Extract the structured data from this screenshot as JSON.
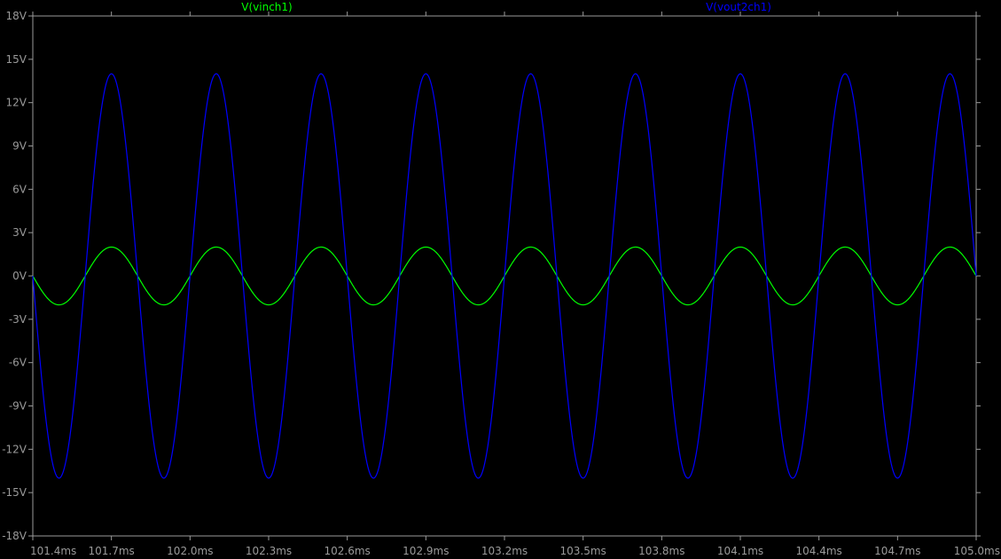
{
  "chart_data": {
    "type": "line",
    "xlabel": "",
    "ylabel": "",
    "xlim": [
      101.4,
      105.0
    ],
    "ylim": [
      -18,
      18
    ],
    "x_unit": "ms",
    "y_unit": "V",
    "x_ticks": [
      "101.4ms",
      "101.7ms",
      "102.0ms",
      "102.3ms",
      "102.6ms",
      "102.9ms",
      "103.2ms",
      "103.5ms",
      "103.8ms",
      "104.1ms",
      "104.4ms",
      "104.7ms",
      "105.0ms"
    ],
    "y_ticks": [
      "18V",
      "15V",
      "12V",
      "9V",
      "6V",
      "3V",
      "0V",
      "-3V",
      "-6V",
      "-9V",
      "-12V",
      "-15V",
      "-18V"
    ],
    "grid": false,
    "legend_position": "top",
    "series": [
      {
        "name": "V(vinch1)",
        "color": "#00ff00",
        "waveform": "sine",
        "amplitude": 2,
        "offset": 0,
        "period_ms": 0.4,
        "x": [
          101.4,
          101.5,
          101.6,
          101.7,
          101.8,
          101.9,
          102.0,
          102.1,
          102.2,
          102.3,
          102.4,
          102.5,
          102.6,
          102.7,
          102.8,
          102.9,
          103.0,
          103.1,
          103.2,
          103.3,
          103.4,
          103.5,
          103.6,
          103.7,
          103.8,
          103.9,
          104.0,
          104.1,
          104.2,
          104.3,
          104.4,
          104.5,
          104.6,
          104.7,
          104.8,
          104.9,
          105.0
        ],
        "values": [
          0,
          -2,
          0,
          2,
          0,
          -2,
          0,
          2,
          0,
          -2,
          0,
          2,
          0,
          -2,
          0,
          2,
          0,
          -2,
          0,
          2,
          0,
          -2,
          0,
          2,
          0,
          -2,
          0,
          2,
          0,
          -2,
          0,
          2,
          0,
          -2,
          0,
          2,
          0
        ]
      },
      {
        "name": "V(vout2ch1)",
        "color": "#0000ff",
        "waveform": "sine",
        "amplitude": 14,
        "offset": 0,
        "period_ms": 0.4,
        "x": [
          101.4,
          101.5,
          101.6,
          101.7,
          101.8,
          101.9,
          102.0,
          102.1,
          102.2,
          102.3,
          102.4,
          102.5,
          102.6,
          102.7,
          102.8,
          102.9,
          103.0,
          103.1,
          103.2,
          103.3,
          103.4,
          103.5,
          103.6,
          103.7,
          103.8,
          103.9,
          104.0,
          104.1,
          104.2,
          104.3,
          104.4,
          104.5,
          104.6,
          104.7,
          104.8,
          104.9,
          105.0
        ],
        "values": [
          0,
          -14,
          0,
          14,
          0,
          -14,
          0,
          14,
          0,
          -14,
          0,
          14,
          0,
          -14,
          0,
          14,
          0,
          -14,
          0,
          14,
          0,
          -14,
          0,
          14,
          0,
          -14,
          0,
          14,
          0,
          -14,
          0,
          14,
          0,
          -14,
          0,
          14,
          0
        ]
      }
    ]
  }
}
